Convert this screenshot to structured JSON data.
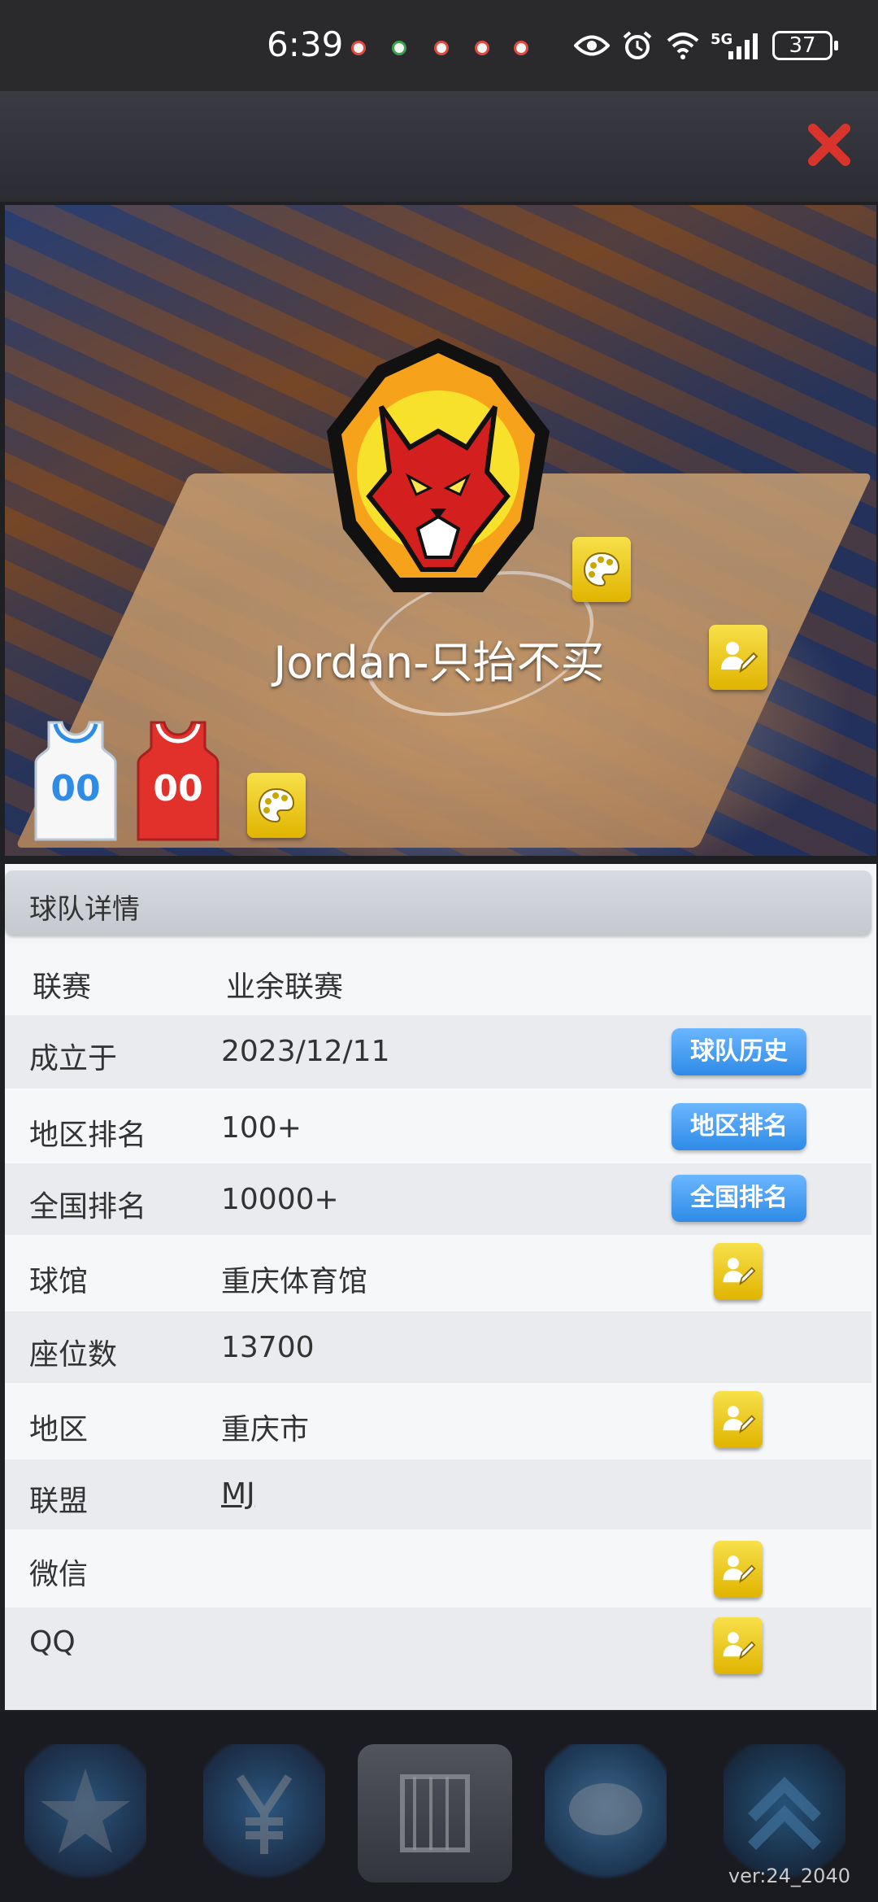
{
  "status_bar": {
    "time": "6:39",
    "network": "5G",
    "battery": "37"
  },
  "hero": {
    "team_name": "Jordan-只抬不买",
    "jersey_home_number": "00",
    "jersey_away_number": "00"
  },
  "details": {
    "section_title": "球队详情",
    "rows": [
      {
        "label": "联赛",
        "value": "业余联赛"
      },
      {
        "label": "成立于",
        "value": "2023/12/11",
        "button": "球队历史"
      },
      {
        "label": "地区排名",
        "value": "100+",
        "button": "地区排名"
      },
      {
        "label": "全国排名",
        "value": "10000+",
        "button": "全国排名"
      },
      {
        "label": "球馆",
        "value": "重庆体育馆"
      },
      {
        "label": "座位数",
        "value": "13700"
      },
      {
        "label": "地区",
        "value": "重庆市"
      },
      {
        "label": "联盟",
        "value": "MJ"
      },
      {
        "label": "微信",
        "value": ""
      },
      {
        "label": "QQ",
        "value": ""
      }
    ]
  },
  "footer": {
    "version": "ver:24_2040"
  },
  "colors": {
    "edit_button": "#f2d21f",
    "blue_button": "#3a93ea",
    "close_red": "#d9342b"
  }
}
